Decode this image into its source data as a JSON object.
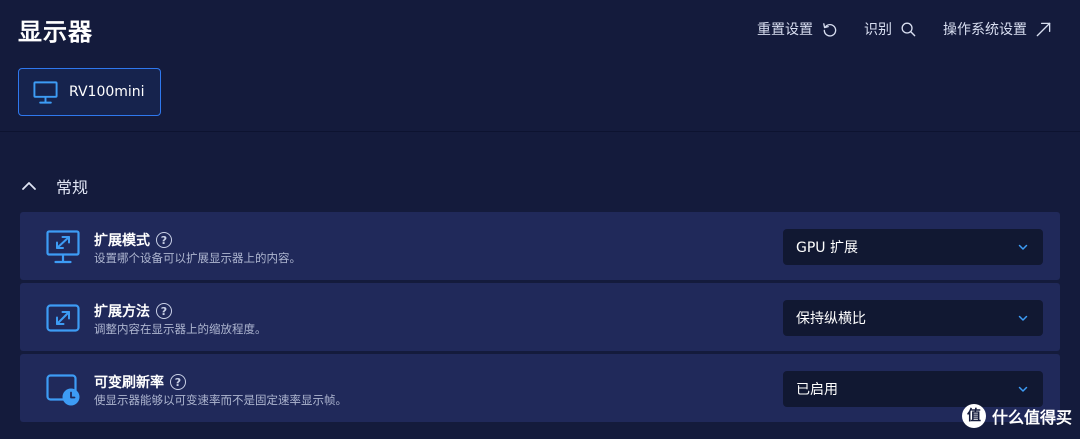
{
  "header": {
    "title": "显示器",
    "actions": [
      {
        "label": "重置设置",
        "icon": "reset-icon"
      },
      {
        "label": "识别",
        "icon": "search-icon"
      },
      {
        "label": "操作系统设置",
        "icon": "external-arrow-icon"
      }
    ]
  },
  "device_tab": {
    "label": "RV100mini",
    "icon": "monitor-icon",
    "selected": true
  },
  "section": {
    "label": "常规",
    "expanded": true,
    "icon": "chevron-up-icon"
  },
  "settings": [
    {
      "title": "扩展模式",
      "description": "设置哪个设备可以扩展显示器上的内容。",
      "value": "GPU 扩展",
      "icon": "monitor-expand-icon"
    },
    {
      "title": "扩展方法",
      "description": "调整内容在显示器上的缩放程度。",
      "value": "保持纵横比",
      "icon": "expand-arrows-icon"
    },
    {
      "title": "可变刷新率",
      "description": "使显示器能够以可变速率而不是固定速率显示帧。",
      "value": "已启用",
      "icon": "refresh-clock-icon"
    }
  ],
  "help_glyph": "?",
  "watermark": {
    "logo_text": "值",
    "text": "什么值得买"
  },
  "colors": {
    "background": "#141b3c",
    "row_background": "#20295a",
    "select_background": "#111832",
    "accent": "#2f78ee",
    "icon_blue": "#3d9cf5"
  }
}
